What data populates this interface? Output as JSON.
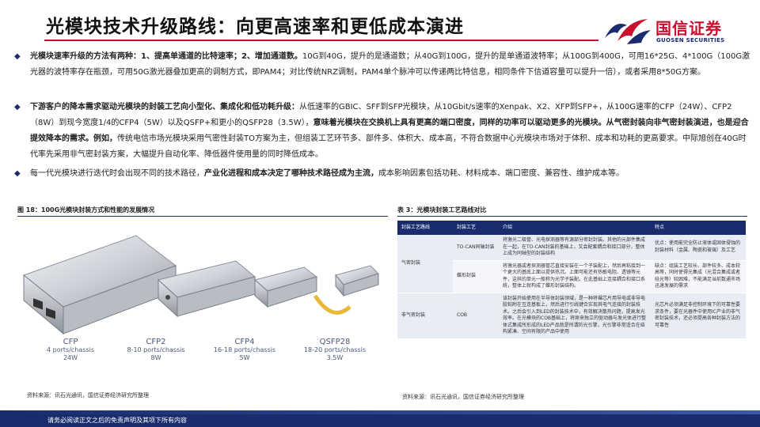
{
  "header": {
    "title": "光模块技术升级路线：向更高速率和更低成本演进",
    "logo_cn": "国信证券",
    "logo_en": "GUOSEN SECURITIES"
  },
  "bullets": [
    {
      "bold": "光模块速率升级的方法有两种：1、提高单通道的比特速率；2、增加通道数。",
      "normal": "10G到40G，提升的是通道数；从40G到100G，提升的是单通道波特率；从100G到400G，可用16*25G、4*100G（100G激光器的波特率存在瓶颈，可用50G激光器叠加更高的调制方式，即PAM4；对比传统NRZ调制，PAM4单个脉冲可以传递两比特信息，相同条件下信道容量可以提升一倍），或者采用8*50G方案。"
    },
    {
      "bold": "下游客户的降本需求驱动光模块的封装工艺向小型化、集成化和低功耗升级：",
      "normal": "从低速率的GBIC、SFF到SFP光模块，从10Gbit/s速率的Xenpak、X2、XFP到SFP+，从100G速率的CFP（24W）、CFP2（8W）到现今宽度1/4的CFP4（5W）以及QSFP+和更小的QSFP28（3.5W），",
      "bold2": "意味着光模块在交换机上具有更高的端口密度，同样的功率可以驱动更多的光模块。从气密封装向非气密封装演进，也是迎合提效降本的需求。例如，",
      "normal2": "传统电信市场光模块采用气密性封装TO方案为主，但组装工艺环节多、部件多、体积大、成本高，不符合数据中心光模块市场对于体积、成本和功耗的更高要求。中际旭创在40G时代率先采用非气密封装方案，大幅提升自动化率、降低器件使用量的同时降低成本。"
    },
    {
      "normal": "每一代光模块进行迭代时会出现不同的技术路径，",
      "bold": "产业化进程和成本决定了哪种技术路径成为主流，",
      "normal2": "成本影响因素包括功耗、材料成本、端口密度、兼容性、维护成本等。"
    }
  ],
  "figure": {
    "title": "图 18：100G光模块封装方式和性能的发展情况",
    "modules": [
      {
        "name": "CFP",
        "ports": "4 ports/chassis",
        "power": "24W"
      },
      {
        "name": "CFP2",
        "ports": "8-10 ports/chassis",
        "power": "8W"
      },
      {
        "name": "CFP4",
        "ports": "16-18 ports/chassis",
        "power": "5W"
      },
      {
        "name": "QSFP28",
        "ports": "18-20 ports/chassis",
        "power": "3.5W"
      }
    ],
    "source": "资料来源：讯石光通讯，国信证券经济研究所整理"
  },
  "table": {
    "title": "表 3：光模块封装工艺路线对比",
    "headers": [
      "封装工艺路线",
      "封装工艺",
      "介绍",
      "特点"
    ],
    "rows": [
      {
        "route": "气密封装",
        "process": "TO-CAN同轴封装",
        "intro": "将激光二极管、光电探测器等有源部分密封封装。其他的元部件集成在一起，在TO-CAN封装的基础上，又会配套耦合和接口部分，整体上成为同轴型的封装结构",
        "feature": "优点：使用能完全防止液体或固体侵蚀的封装材料（金属、陶瓷和玻璃）及工艺"
      },
      {
        "route": "",
        "process": "蝶形封装",
        "intro": "将激光器或者探测器管芯直接安装在一个子装配上，然后再粘接到一个更大的基底上面以提供热沉。上面可能还有热敏电阻、透镜等元件，这样的单元一般称为光学子装配。在此基础上连接耦合和接口系统，整体上就构成了蝶形封装结构。",
        "feature": "缺点：组装工艺较长、部件较多、成本较高等，同时使得光集成（光混合集成或者硅光等）较困难，不能满足当前数通市场迅速发展的需求"
      },
      {
        "route": "非气密封装",
        "process": "COB",
        "intro": "该封装开始使用在半导体封装领域，是一种将裸芯片用导电或非导电胶粘附在互连基板上，然后进行引线键合实现其电气连接的封装技术。之后会引入到LED的封装技术中，有效解决散热问题，提高发光效率。在光模块的COB基础上，将原来独立的驱动器与发光体进行整体式集成所形成的LED产品就是所谓的光引擎，光引擎非常适合在结构紧凑、空间有限的产品中使用",
        "feature": "光芯片必须满足非控制环境下的可靠性要求条件，要在光器件中使用IC产业的非气密封装技术，还必须提高各种封装方法的可靠性"
      }
    ],
    "source": "资料来源：讯石光通讯，国信证券经济研究所整理"
  },
  "footer": {
    "text": "请务必阅读正文之后的免责声明及其项下所有内容"
  },
  "colors": {
    "brand_navy": "#1a2c6e",
    "brand_red": "#c8102e"
  }
}
